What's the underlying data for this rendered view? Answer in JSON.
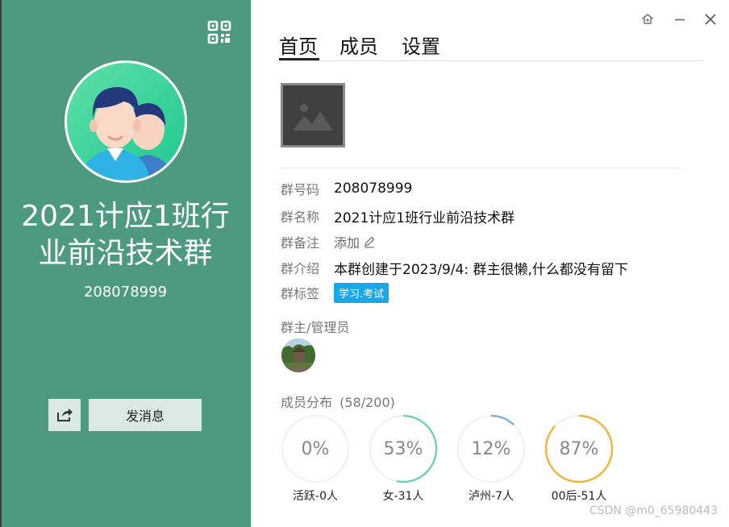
{
  "left": {
    "group_name": "2021计应1班行业前沿技术群",
    "group_id": "208078999",
    "send_message_label": "发消息",
    "icons": {
      "qr": "qr-code-icon",
      "share": "share-icon",
      "avatar": "group-avatar"
    },
    "bg_color": "#4e9a80"
  },
  "window": {
    "icons": [
      "pin-icon",
      "minimize-icon",
      "close-icon"
    ]
  },
  "tabs": [
    {
      "label": "首页",
      "active": true
    },
    {
      "label": "成员",
      "active": false
    },
    {
      "label": "设置",
      "active": false
    }
  ],
  "info": {
    "id_label": "群号码",
    "id_value": "208078999",
    "name_label": "群名称",
    "name_value": "2021计应1班行业前沿技术群",
    "note_label": "群备注",
    "note_action": "添加",
    "intro_label": "群介绍",
    "intro_value": "本群创建于2023/9/4:  群主很懒,什么都没有留下",
    "tags_label": "群标签",
    "tag_value": "学习.考试"
  },
  "admins": {
    "title": "群主/管理员"
  },
  "distribution": {
    "title": "成员分布",
    "count": "(58/200)",
    "stats": [
      {
        "percent_text": "0%",
        "value": 0,
        "label": "活跃-0人",
        "color": "#f0f0f0"
      },
      {
        "percent_text": "53%",
        "value": 53,
        "label": "女-31人",
        "color": "#6fd3a9"
      },
      {
        "percent_text": "12%",
        "value": 12,
        "label": "泸州-7人",
        "color": "#7fb0dc"
      },
      {
        "percent_text": "87%",
        "value": 87,
        "label": "00后-51人",
        "color": "#f2b23e"
      }
    ]
  },
  "watermark": "CSDN @m0_65980443"
}
